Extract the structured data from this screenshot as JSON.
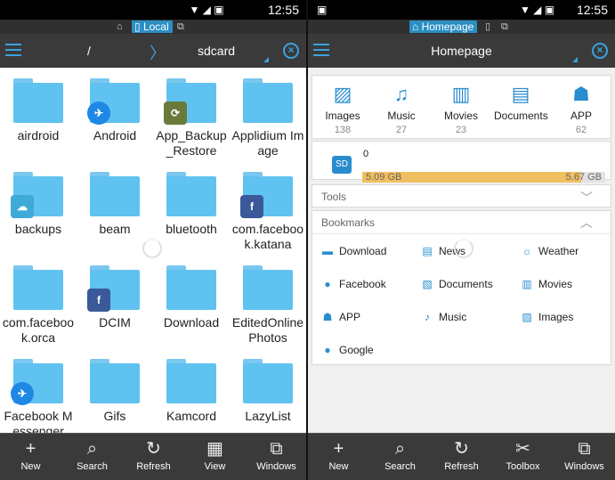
{
  "status": {
    "time_left": "12:55",
    "time_right": "12:55"
  },
  "left": {
    "tab_chip": "Local",
    "toolbar": {
      "path_root": "/",
      "path_current": "sdcard"
    },
    "folders": [
      {
        "name": "airdroid",
        "badge": ""
      },
      {
        "name": "Android",
        "badge": "messenger"
      },
      {
        "name": "App_Backup_Restore",
        "badge": "app-backup"
      },
      {
        "name": "Applidium Image",
        "badge": ""
      },
      {
        "name": "backups",
        "badge": "backups"
      },
      {
        "name": "beam",
        "badge": ""
      },
      {
        "name": "bluetooth",
        "badge": ""
      },
      {
        "name": "com.facebook.katana",
        "badge": "facebook"
      },
      {
        "name": "com.facebook.orca",
        "badge": ""
      },
      {
        "name": "DCIM",
        "badge": "facebook"
      },
      {
        "name": "Download",
        "badge": ""
      },
      {
        "name": "EditedOnlinePhotos",
        "badge": ""
      },
      {
        "name": "Facebook Messenger",
        "badge": "messenger"
      },
      {
        "name": "Gifs",
        "badge": ""
      },
      {
        "name": "Kamcord",
        "badge": ""
      },
      {
        "name": "LazyList",
        "badge": ""
      }
    ],
    "bottom": [
      {
        "label": "New",
        "icon": "plus-icon"
      },
      {
        "label": "Search",
        "icon": "search-icon"
      },
      {
        "label": "Refresh",
        "icon": "refresh-icon"
      },
      {
        "label": "View",
        "icon": "grid-view-icon"
      },
      {
        "label": "Windows",
        "icon": "windows-icon"
      }
    ]
  },
  "right": {
    "tab_chip": "Homepage",
    "toolbar": {
      "title": "Homepage"
    },
    "categories": [
      {
        "name": "Images",
        "count": "138",
        "icon": "image-icon"
      },
      {
        "name": "Music",
        "count": "27",
        "icon": "music-icon"
      },
      {
        "name": "Movies",
        "count": "23",
        "icon": "movie-icon"
      },
      {
        "name": "Documents",
        "count": "",
        "icon": "book-icon"
      },
      {
        "name": "APP",
        "count": "62",
        "icon": "android-icon"
      }
    ],
    "storage": {
      "badge": "SD",
      "count": "0",
      "used": "5.09 GB",
      "total": "5.67 GB",
      "fill_fraction": 0.9
    },
    "sections": {
      "tools": "Tools",
      "bookmarks": "Bookmarks"
    },
    "bookmarks": [
      {
        "label": "Download",
        "icon": "download-folder-icon"
      },
      {
        "label": "News",
        "icon": "news-icon"
      },
      {
        "label": "Weather",
        "icon": "weather-icon"
      },
      {
        "label": "Facebook",
        "icon": "globe-icon"
      },
      {
        "label": "Documents",
        "icon": "documents-icon"
      },
      {
        "label": "Movies",
        "icon": "movies-icon"
      },
      {
        "label": "APP",
        "icon": "app-icon"
      },
      {
        "label": "Music",
        "icon": "music-note-icon"
      },
      {
        "label": "Images",
        "icon": "images-icon"
      },
      {
        "label": "Google",
        "icon": "globe-icon"
      }
    ],
    "bottom": [
      {
        "label": "New",
        "icon": "plus-icon"
      },
      {
        "label": "Search",
        "icon": "search-icon"
      },
      {
        "label": "Refresh",
        "icon": "refresh-icon"
      },
      {
        "label": "Toolbox",
        "icon": "toolbox-icon"
      },
      {
        "label": "Windows",
        "icon": "windows-icon"
      }
    ]
  },
  "colors": {
    "accent": "#3aa2e0",
    "folder": "#5fc2f0",
    "bar": "#3a3a3a"
  }
}
